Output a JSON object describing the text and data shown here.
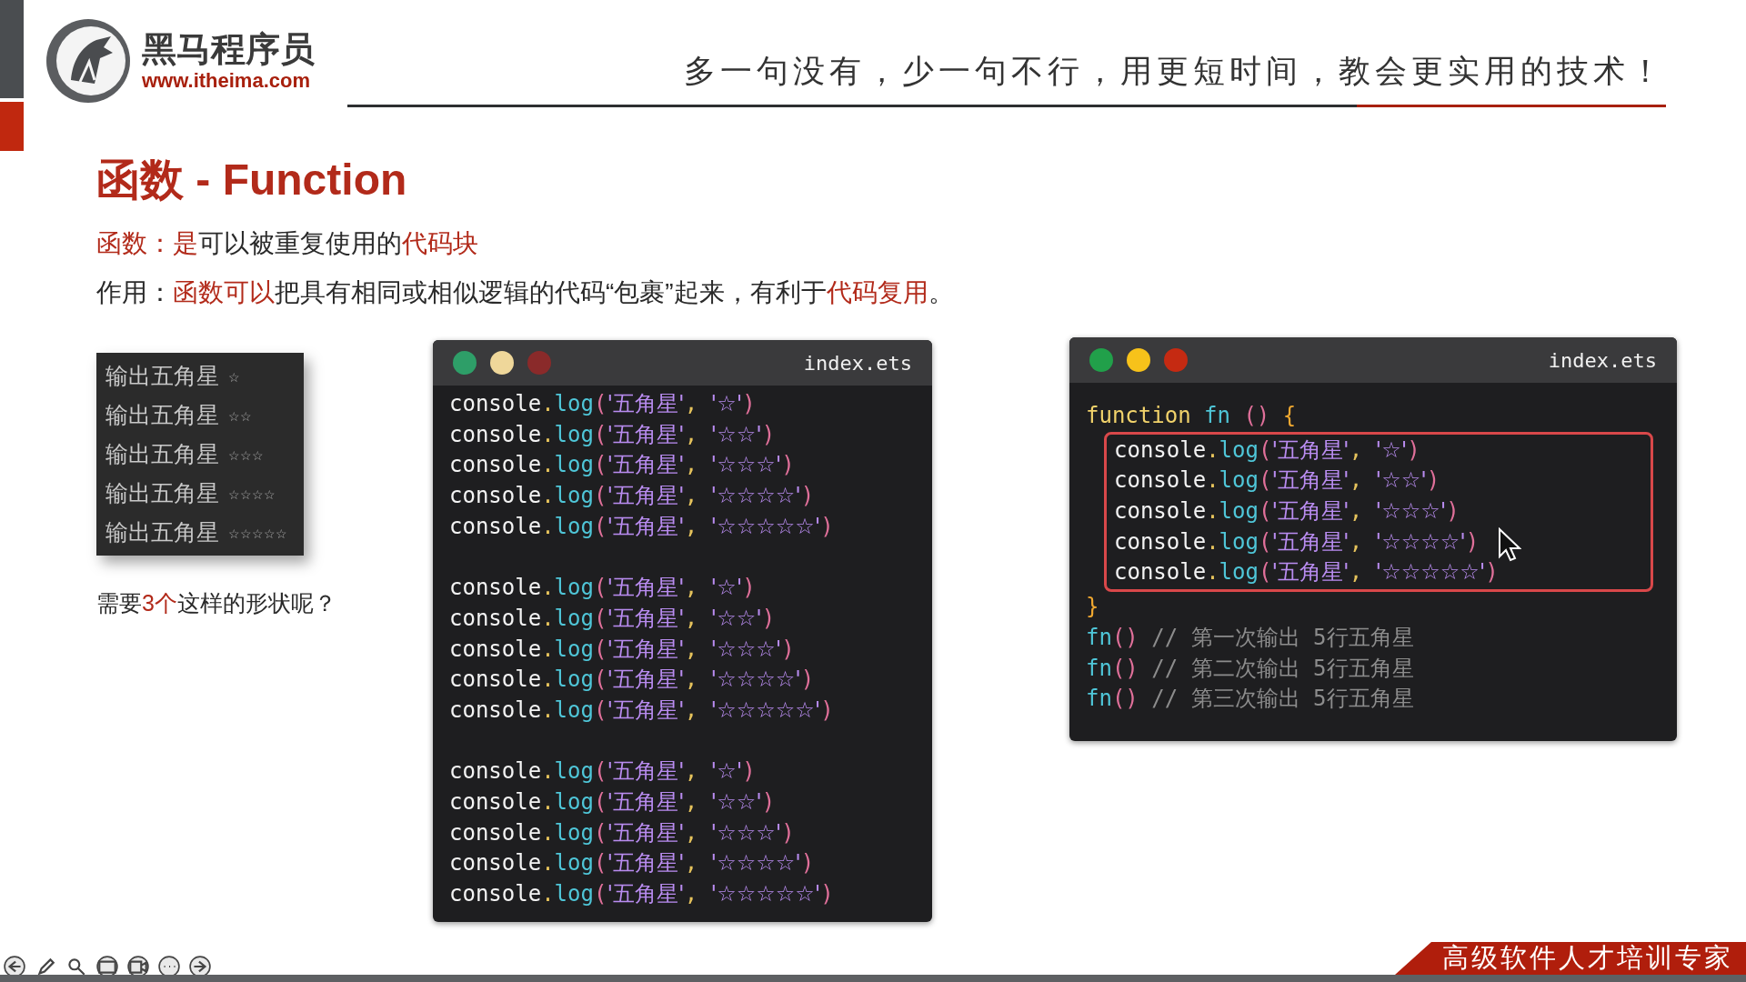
{
  "header": {
    "brand": "黑马程序员",
    "url": "www.itheima.com",
    "slogan": "多一句没有，少一句不行，用更短时间，教会更实用的技术！"
  },
  "title": "函数 - Function",
  "definitions": [
    {
      "segments": [
        {
          "text": "函数：是",
          "highlight": true
        },
        {
          "text": "可以被重复使用的",
          "highlight": false
        },
        {
          "text": "代码块",
          "highlight": true
        }
      ]
    },
    {
      "segments": [
        {
          "text": "作用：",
          "highlight": false
        },
        {
          "text": "函数可以",
          "highlight": true
        },
        {
          "text": "把具有相同或相似逻辑的代码“包裹”起来，有利于",
          "highlight": false
        },
        {
          "text": "代码复用",
          "highlight": true
        },
        {
          "text": "。",
          "highlight": false
        }
      ]
    }
  ],
  "output_panel": {
    "items": [
      {
        "label": "输出五角星",
        "stars": "☆"
      },
      {
        "label": "输出五角星",
        "stars": "☆☆"
      },
      {
        "label": "输出五角星",
        "stars": "☆☆☆"
      },
      {
        "label": "输出五角星",
        "stars": "☆☆☆☆"
      },
      {
        "label": "输出五角星",
        "stars": "☆☆☆☆☆"
      }
    ]
  },
  "question": {
    "segments": [
      {
        "text": "需要",
        "highlight": false
      },
      {
        "text": "3个",
        "highlight": true
      },
      {
        "text": "这样的形状呢？",
        "highlight": false
      }
    ]
  },
  "editors": [
    {
      "filename": "index.ets",
      "dots": [
        {
          "color": "#2e9e68"
        },
        {
          "color": "#efd79a"
        },
        {
          "color": "#8a2a2a"
        }
      ],
      "lines": [
        {
          "kind": "stmt",
          "text": "console.log('五角星', '☆')",
          "boxed": false
        },
        {
          "kind": "stmt",
          "text": "console.log('五角星', '☆☆')",
          "boxed": false
        },
        {
          "kind": "stmt",
          "text": "console.log('五角星', '☆☆☆')",
          "boxed": false
        },
        {
          "kind": "stmt",
          "text": "console.log('五角星', '☆☆☆☆')",
          "boxed": false
        },
        {
          "kind": "stmt",
          "text": "console.log('五角星', '☆☆☆☆☆')",
          "boxed": false
        },
        {
          "kind": "blank",
          "boxed": false
        },
        {
          "kind": "stmt",
          "text": "console.log('五角星', '☆')",
          "boxed": false
        },
        {
          "kind": "stmt",
          "text": "console.log('五角星', '☆☆')",
          "boxed": false
        },
        {
          "kind": "stmt",
          "text": "console.log('五角星', '☆☆☆')",
          "boxed": false
        },
        {
          "kind": "stmt",
          "text": "console.log('五角星', '☆☆☆☆')",
          "boxed": false
        },
        {
          "kind": "stmt",
          "text": "console.log('五角星', '☆☆☆☆☆')",
          "boxed": false
        },
        {
          "kind": "blank",
          "boxed": false
        },
        {
          "kind": "stmt",
          "text": "console.log('五角星', '☆')",
          "boxed": false
        },
        {
          "kind": "stmt",
          "text": "console.log('五角星', '☆☆')",
          "boxed": false
        },
        {
          "kind": "stmt",
          "text": "console.log('五角星', '☆☆☆')",
          "boxed": false
        },
        {
          "kind": "stmt",
          "text": "console.log('五角星', '☆☆☆☆')",
          "boxed": false
        },
        {
          "kind": "stmt",
          "text": "console.log('五角星', '☆☆☆☆☆')",
          "boxed": false
        }
      ]
    },
    {
      "filename": "index.ets",
      "dots": [
        {
          "color": "#21a04a"
        },
        {
          "color": "#f7c21a"
        },
        {
          "color": "#c52a12"
        }
      ],
      "lines": [
        {
          "kind": "decl",
          "text": "function fn () {",
          "boxed": false
        },
        {
          "kind": "stmt",
          "text": "console.log('五角星', '☆')",
          "boxed": true
        },
        {
          "kind": "stmt",
          "text": "console.log('五角星', '☆☆')",
          "boxed": true
        },
        {
          "kind": "stmt",
          "text": "console.log('五角星', '☆☆☆')",
          "boxed": true
        },
        {
          "kind": "stmt",
          "text": "console.log('五角星', '☆☆☆☆')",
          "boxed": true
        },
        {
          "kind": "stmt",
          "text": "console.log('五角星', '☆☆☆☆☆')",
          "boxed": true
        },
        {
          "kind": "close",
          "text": "}",
          "boxed": false
        },
        {
          "kind": "call",
          "text": "fn() // 第一次输出 5行五角星",
          "boxed": false
        },
        {
          "kind": "call",
          "text": "fn() // 第二次输出 5行五角星",
          "boxed": false
        },
        {
          "kind": "call",
          "text": "fn() // 第三次输出 5行五角星",
          "boxed": false
        }
      ]
    }
  ],
  "footer": {
    "banner": "高级软件人才培训专家"
  }
}
